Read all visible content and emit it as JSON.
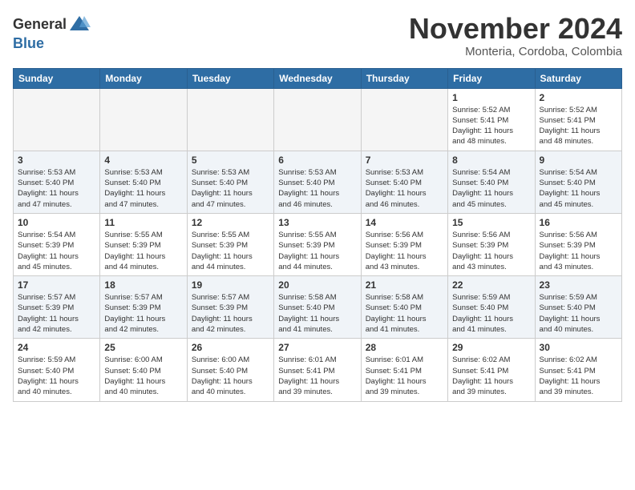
{
  "logo": {
    "general": "General",
    "blue": "Blue"
  },
  "header": {
    "month": "November 2024",
    "location": "Monteria, Cordoba, Colombia"
  },
  "weekdays": [
    "Sunday",
    "Monday",
    "Tuesday",
    "Wednesday",
    "Thursday",
    "Friday",
    "Saturday"
  ],
  "weeks": [
    [
      {
        "day": "",
        "info": ""
      },
      {
        "day": "",
        "info": ""
      },
      {
        "day": "",
        "info": ""
      },
      {
        "day": "",
        "info": ""
      },
      {
        "day": "",
        "info": ""
      },
      {
        "day": "1",
        "info": "Sunrise: 5:52 AM\nSunset: 5:41 PM\nDaylight: 11 hours\nand 48 minutes."
      },
      {
        "day": "2",
        "info": "Sunrise: 5:52 AM\nSunset: 5:41 PM\nDaylight: 11 hours\nand 48 minutes."
      }
    ],
    [
      {
        "day": "3",
        "info": "Sunrise: 5:53 AM\nSunset: 5:40 PM\nDaylight: 11 hours\nand 47 minutes."
      },
      {
        "day": "4",
        "info": "Sunrise: 5:53 AM\nSunset: 5:40 PM\nDaylight: 11 hours\nand 47 minutes."
      },
      {
        "day": "5",
        "info": "Sunrise: 5:53 AM\nSunset: 5:40 PM\nDaylight: 11 hours\nand 47 minutes."
      },
      {
        "day": "6",
        "info": "Sunrise: 5:53 AM\nSunset: 5:40 PM\nDaylight: 11 hours\nand 46 minutes."
      },
      {
        "day": "7",
        "info": "Sunrise: 5:53 AM\nSunset: 5:40 PM\nDaylight: 11 hours\nand 46 minutes."
      },
      {
        "day": "8",
        "info": "Sunrise: 5:54 AM\nSunset: 5:40 PM\nDaylight: 11 hours\nand 45 minutes."
      },
      {
        "day": "9",
        "info": "Sunrise: 5:54 AM\nSunset: 5:40 PM\nDaylight: 11 hours\nand 45 minutes."
      }
    ],
    [
      {
        "day": "10",
        "info": "Sunrise: 5:54 AM\nSunset: 5:39 PM\nDaylight: 11 hours\nand 45 minutes."
      },
      {
        "day": "11",
        "info": "Sunrise: 5:55 AM\nSunset: 5:39 PM\nDaylight: 11 hours\nand 44 minutes."
      },
      {
        "day": "12",
        "info": "Sunrise: 5:55 AM\nSunset: 5:39 PM\nDaylight: 11 hours\nand 44 minutes."
      },
      {
        "day": "13",
        "info": "Sunrise: 5:55 AM\nSunset: 5:39 PM\nDaylight: 11 hours\nand 44 minutes."
      },
      {
        "day": "14",
        "info": "Sunrise: 5:56 AM\nSunset: 5:39 PM\nDaylight: 11 hours\nand 43 minutes."
      },
      {
        "day": "15",
        "info": "Sunrise: 5:56 AM\nSunset: 5:39 PM\nDaylight: 11 hours\nand 43 minutes."
      },
      {
        "day": "16",
        "info": "Sunrise: 5:56 AM\nSunset: 5:39 PM\nDaylight: 11 hours\nand 43 minutes."
      }
    ],
    [
      {
        "day": "17",
        "info": "Sunrise: 5:57 AM\nSunset: 5:39 PM\nDaylight: 11 hours\nand 42 minutes."
      },
      {
        "day": "18",
        "info": "Sunrise: 5:57 AM\nSunset: 5:39 PM\nDaylight: 11 hours\nand 42 minutes."
      },
      {
        "day": "19",
        "info": "Sunrise: 5:57 AM\nSunset: 5:39 PM\nDaylight: 11 hours\nand 42 minutes."
      },
      {
        "day": "20",
        "info": "Sunrise: 5:58 AM\nSunset: 5:40 PM\nDaylight: 11 hours\nand 41 minutes."
      },
      {
        "day": "21",
        "info": "Sunrise: 5:58 AM\nSunset: 5:40 PM\nDaylight: 11 hours\nand 41 minutes."
      },
      {
        "day": "22",
        "info": "Sunrise: 5:59 AM\nSunset: 5:40 PM\nDaylight: 11 hours\nand 41 minutes."
      },
      {
        "day": "23",
        "info": "Sunrise: 5:59 AM\nSunset: 5:40 PM\nDaylight: 11 hours\nand 40 minutes."
      }
    ],
    [
      {
        "day": "24",
        "info": "Sunrise: 5:59 AM\nSunset: 5:40 PM\nDaylight: 11 hours\nand 40 minutes."
      },
      {
        "day": "25",
        "info": "Sunrise: 6:00 AM\nSunset: 5:40 PM\nDaylight: 11 hours\nand 40 minutes."
      },
      {
        "day": "26",
        "info": "Sunrise: 6:00 AM\nSunset: 5:40 PM\nDaylight: 11 hours\nand 40 minutes."
      },
      {
        "day": "27",
        "info": "Sunrise: 6:01 AM\nSunset: 5:41 PM\nDaylight: 11 hours\nand 39 minutes."
      },
      {
        "day": "28",
        "info": "Sunrise: 6:01 AM\nSunset: 5:41 PM\nDaylight: 11 hours\nand 39 minutes."
      },
      {
        "day": "29",
        "info": "Sunrise: 6:02 AM\nSunset: 5:41 PM\nDaylight: 11 hours\nand 39 minutes."
      },
      {
        "day": "30",
        "info": "Sunrise: 6:02 AM\nSunset: 5:41 PM\nDaylight: 11 hours\nand 39 minutes."
      }
    ]
  ]
}
